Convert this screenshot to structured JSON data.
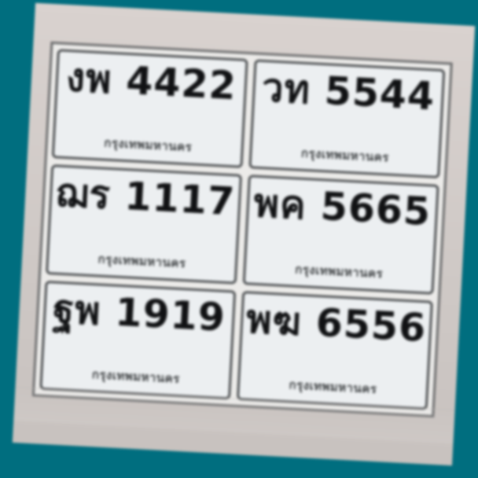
{
  "plates": [
    {
      "registration": "งพ 4422",
      "province": "กรุงเทพมหานคร"
    },
    {
      "registration": "วท 5544",
      "province": "กรุงเทพมหานคร"
    },
    {
      "registration": "ฌร 1117",
      "province": "กรุงเทพมหานคร"
    },
    {
      "registration": "พค 5665",
      "province": "กรุงเทพมหานคร"
    },
    {
      "registration": "ฐพ 1919",
      "province": "กรุงเทพมหานคร"
    },
    {
      "registration": "พฆ 6556",
      "province": "กรุงเทพมหานคร"
    }
  ]
}
